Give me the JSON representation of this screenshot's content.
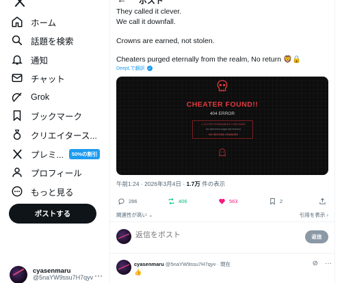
{
  "sidebar": {
    "items": [
      {
        "icon": "home-icon",
        "label": "ホーム"
      },
      {
        "icon": "search-icon",
        "label": "話題を検索"
      },
      {
        "icon": "bell-icon",
        "label": "通知"
      },
      {
        "icon": "mail-icon",
        "label": "チャット"
      },
      {
        "icon": "grok-icon",
        "label": "Grok"
      },
      {
        "icon": "bookmark-icon",
        "label": "ブックマーク"
      },
      {
        "icon": "creator-icon",
        "label": "クリエイタース..."
      },
      {
        "icon": "x-icon",
        "label": "プレミ...",
        "badge": "50%の割引"
      },
      {
        "icon": "person-icon",
        "label": "プロフィール"
      },
      {
        "icon": "more-icon",
        "label": "もっと見る"
      }
    ],
    "post_button": "ポストする",
    "account": {
      "name": "cyasenmaru",
      "handle": "@5naYW9ssu7H7qyv"
    }
  },
  "header": {
    "title": "ポスト"
  },
  "tweet": {
    "lines": [
      "They called it clever.",
      "We call it downfall.",
      "Crowns are earned, not stolen.",
      "Cheaters purged eternally from the realm, No return 🦁🔒"
    ],
    "translate_link": "DeepLで翻訳"
  },
  "media": {
    "title": "CHEATER FOUND!!",
    "code": "404 ERROR",
    "warning1": "⚠ ACCESS PERMANENTLY REVOKED",
    "warning2": "You have been caught and removed.",
    "warning3": "NO SECOND CHANCES"
  },
  "meta": {
    "time": "午前1:24 · 2026年3月4日 · ",
    "views": "1.7万",
    "views_label": " 件の表示"
  },
  "actions": {
    "replies": "286",
    "reposts": "406",
    "likes": "563",
    "bookmarks": "2"
  },
  "sort": {
    "left": "関連性が高い ⌄",
    "right": "引用を表示 ›"
  },
  "reply_box": {
    "placeholder": "返信をポスト",
    "button": "返信"
  },
  "reply": {
    "name": "cyasenmaru",
    "handle": "@5naYW9ssu7H7qyv",
    "time": "· 現在",
    "body": "👍"
  },
  "colors": {
    "accent": "#1d9bf0",
    "repost": "#00ba7c",
    "like": "#f91880",
    "alert": "#e0393e"
  }
}
